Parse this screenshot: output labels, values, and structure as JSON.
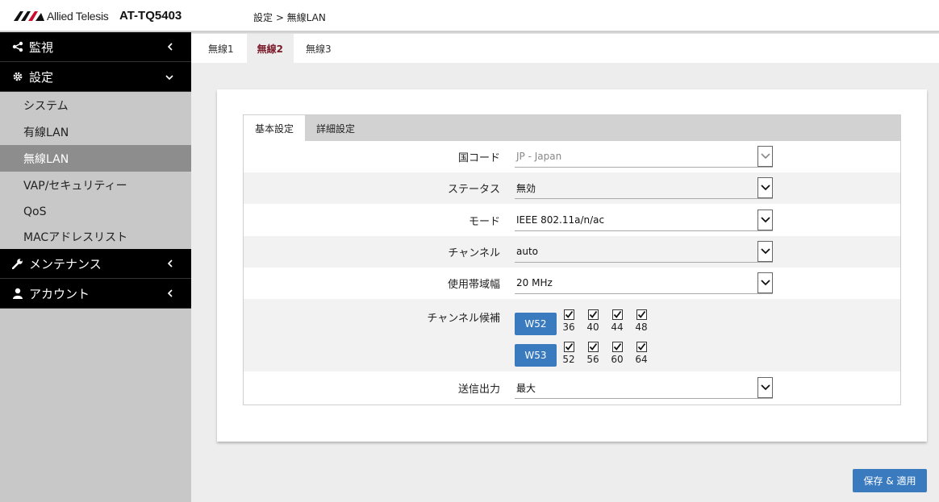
{
  "header": {
    "logo_text": "Allied Telesis",
    "model": "AT-TQ5403",
    "breadcrumb": "設定 > 無線LAN"
  },
  "sidebar": {
    "monitor": "監視",
    "settings": "設定",
    "sub_items": [
      "システム",
      "有線LAN",
      "無線LAN",
      "VAP/セキュリティー",
      "QoS",
      "MACアドレスリスト"
    ],
    "maintenance": "メンテナンス",
    "account": "アカウント"
  },
  "top_tabs": [
    "無線1",
    "無線2",
    "無線3"
  ],
  "inner_tabs": [
    "基本設定",
    "詳細設定"
  ],
  "form": {
    "country_label": "国コード",
    "country_value": "JP - Japan",
    "status_label": "ステータス",
    "status_value": "無効",
    "mode_label": "モード",
    "mode_value": "IEEE 802.11a/n/ac",
    "channel_label": "チャンネル",
    "channel_value": "auto",
    "bandwidth_label": "使用帯域幅",
    "bandwidth_value": "20 MHz",
    "candidates_label": "チャンネル候補",
    "w52_label": "W52",
    "w52_channels": [
      "36",
      "40",
      "44",
      "48"
    ],
    "w53_label": "W53",
    "w53_channels": [
      "52",
      "56",
      "60",
      "64"
    ],
    "power_label": "送信出力",
    "power_value": "最大"
  },
  "save_label": "保存 & 適用",
  "colors": {
    "accent": "#3a7bbf",
    "active_tab": "#7a1a2a"
  }
}
